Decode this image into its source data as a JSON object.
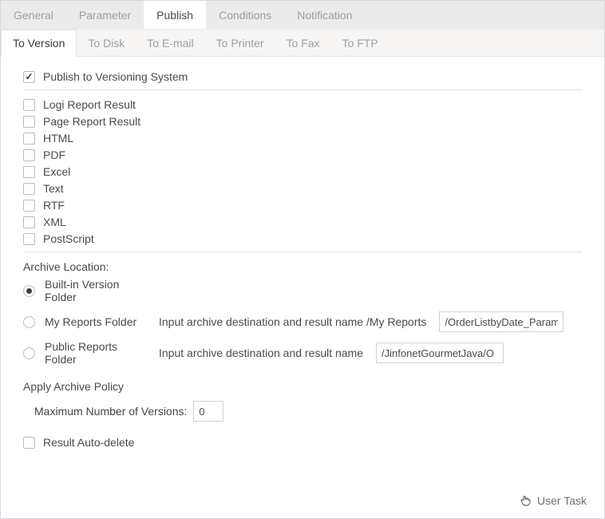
{
  "primaryTabs": {
    "general": "General",
    "parameter": "Parameter",
    "publish": "Publish",
    "conditions": "Conditions",
    "notification": "Notification"
  },
  "subTabs": {
    "toVersion": "To Version",
    "toDisk": "To Disk",
    "toEmail": "To E-mail",
    "toPrinter": "To Printer",
    "toFax": "To Fax",
    "toFtp": "To FTP"
  },
  "publishToVersioning": "Publish to Versioning System",
  "formats": {
    "logi": "Logi Report Result",
    "page": "Page Report Result",
    "html": "HTML",
    "pdf": "PDF",
    "excel": "Excel",
    "text": "Text",
    "rtf": "RTF",
    "xml": "XML",
    "postscript": "PostScript"
  },
  "archive": {
    "title": "Archive Location:",
    "builtin": "Built-in Version Folder",
    "myReports": "My Reports Folder",
    "myReportsHint": "Input archive destination and result name /My Reports",
    "myReportsValue": "/OrderListbyDate_Param",
    "publicReports": "Public Reports Folder",
    "publicReportsHint": "Input archive destination and result name",
    "publicReportsValue": "/JinfonetGourmetJava/O"
  },
  "policy": {
    "title": "Apply Archive Policy",
    "maxVersionsLabel": "Maximum Number of Versions:",
    "maxVersionsValue": "0"
  },
  "autoDelete": "Result Auto-delete",
  "footer": {
    "userTask": "User Task"
  }
}
